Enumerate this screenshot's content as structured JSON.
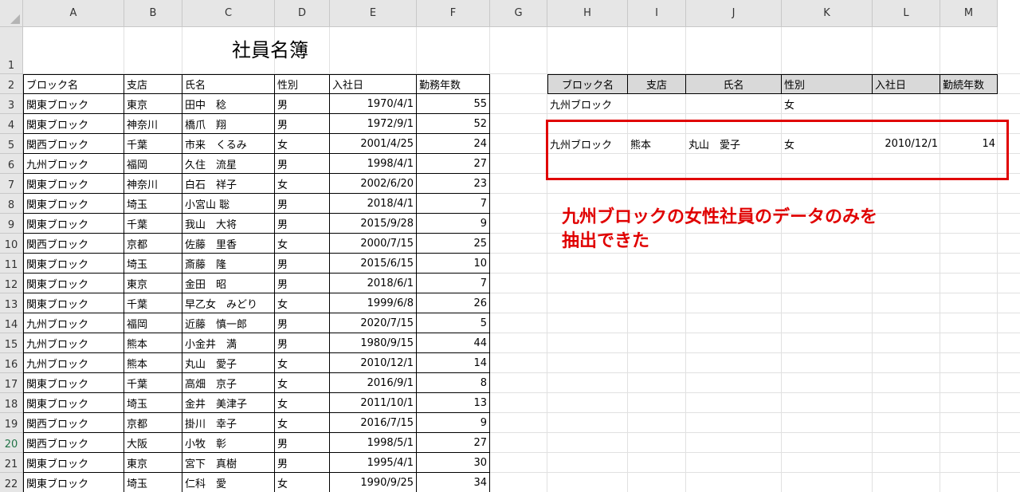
{
  "columns": [
    "A",
    "B",
    "C",
    "D",
    "E",
    "F",
    "G",
    "H",
    "I",
    "J",
    "K",
    "L",
    "M"
  ],
  "rows": [
    "1",
    "2",
    "3",
    "4",
    "5",
    "6",
    "7",
    "8",
    "9",
    "10",
    "11",
    "12",
    "13",
    "14",
    "15",
    "16",
    "17",
    "18",
    "19",
    "20",
    "21",
    "22"
  ],
  "selected_row": "20",
  "title": "社員名簿",
  "table": {
    "headers": [
      "ブロック名",
      "支店",
      "氏名",
      "性別",
      "入社日",
      "勤務年数"
    ],
    "records": [
      [
        "関東ブロック",
        "東京",
        "田中　稔",
        "男",
        "1970/4/1",
        "55"
      ],
      [
        "関東ブロック",
        "神奈川",
        "橋爪　翔",
        "男",
        "1972/9/1",
        "52"
      ],
      [
        "関西ブロック",
        "千葉",
        "市来　くるみ",
        "女",
        "2001/4/25",
        "24"
      ],
      [
        "九州ブロック",
        "福岡",
        "久住　流星",
        "男",
        "1998/4/1",
        "27"
      ],
      [
        "関東ブロック",
        "神奈川",
        "白石　祥子",
        "女",
        "2002/6/20",
        "23"
      ],
      [
        "関東ブロック",
        "埼玉",
        "小宮山 聡",
        "男",
        "2018/4/1",
        "7"
      ],
      [
        "関東ブロック",
        "千葉",
        "我山　大将",
        "男",
        "2015/9/28",
        "9"
      ],
      [
        "関西ブロック",
        "京都",
        "佐藤　里香",
        "女",
        "2000/7/15",
        "25"
      ],
      [
        "関東ブロック",
        "埼玉",
        "斎藤　隆",
        "男",
        "2015/6/15",
        "10"
      ],
      [
        "関東ブロック",
        "東京",
        "金田　昭",
        "男",
        "2018/6/1",
        "7"
      ],
      [
        "関東ブロック",
        "千葉",
        "早乙女　みどり",
        "女",
        "1999/6/8",
        "26"
      ],
      [
        "九州ブロック",
        "福岡",
        "近藤　慎一郎",
        "男",
        "2020/7/15",
        "5"
      ],
      [
        "九州ブロック",
        "熊本",
        "小金井　満",
        "男",
        "1980/9/15",
        "44"
      ],
      [
        "九州ブロック",
        "熊本",
        "丸山　愛子",
        "女",
        "2010/12/1",
        "14"
      ],
      [
        "関東ブロック",
        "千葉",
        "高畑　京子",
        "女",
        "2016/9/1",
        "8"
      ],
      [
        "関東ブロック",
        "埼玉",
        "金井　美津子",
        "女",
        "2011/10/1",
        "13"
      ],
      [
        "関西ブロック",
        "京都",
        "掛川　幸子",
        "女",
        "2016/7/15",
        "9"
      ],
      [
        "関西ブロック",
        "大阪",
        "小牧　彰",
        "男",
        "1998/5/1",
        "27"
      ],
      [
        "関東ブロック",
        "東京",
        "宮下　真樹",
        "男",
        "1995/4/1",
        "30"
      ],
      [
        "関東ブロック",
        "埼玉",
        "仁科　愛",
        "女",
        "1990/9/25",
        "34"
      ]
    ]
  },
  "criteria": {
    "headers": [
      "ブロック名",
      "支店",
      "氏名",
      "性別",
      "入社日",
      "勤続年数"
    ],
    "values": [
      "九州ブロック",
      "",
      "",
      "女",
      "",
      ""
    ]
  },
  "result": {
    "values": [
      "九州ブロック",
      "熊本",
      "丸山　愛子",
      "女",
      "2010/12/1",
      "14"
    ]
  },
  "annotation": {
    "line1": "九州ブロックの女性社員のデータのみを",
    "line2": "抽出できた"
  },
  "colors": {
    "annotation": "#e00000",
    "header_bg": "#e6e6e6",
    "criteria_header_bg": "#d9d9d9"
  }
}
